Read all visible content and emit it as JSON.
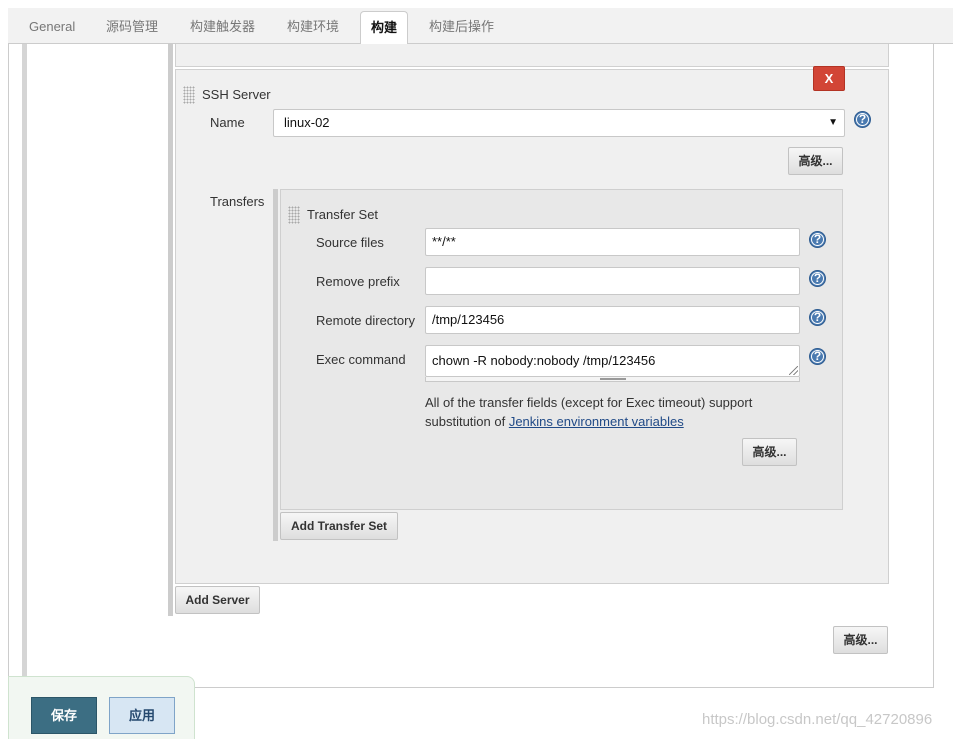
{
  "tabs": [
    {
      "label": "General"
    },
    {
      "label": "源码管理"
    },
    {
      "label": "构建触发器"
    },
    {
      "label": "构建环境"
    },
    {
      "label": "构建",
      "active": true
    },
    {
      "label": "构建后操作"
    }
  ],
  "ssh_server": {
    "section_label": "SSH Server",
    "delete_label": "X",
    "name_label": "Name",
    "name_value": "linux-02",
    "advanced_label": "高级...",
    "transfers_label": "Transfers"
  },
  "transfer_set": {
    "section_label": "Transfer Set",
    "source_files_label": "Source files",
    "source_files_value": "**/**",
    "remove_prefix_label": "Remove prefix",
    "remove_prefix_value": "",
    "remote_directory_label": "Remote directory",
    "remote_directory_value": "/tmp/123456",
    "exec_command_label": "Exec command",
    "exec_command_value": "chown -R nobody:nobody /tmp/123456",
    "note_prefix": "All of the transfer fields (except for Exec timeout) support substitution of ",
    "note_link": "Jenkins environment variables",
    "advanced_label": "高级...",
    "add_transfer_set_label": "Add Transfer Set"
  },
  "add_server_label": "Add Server",
  "build_advanced_label": "高级...",
  "footer": {
    "save_label": "保存",
    "apply_label": "应用"
  },
  "watermark": "https://blog.csdn.net/qq_42720896",
  "icons": {
    "help": "help-icon",
    "drag": "drag-handle-icon"
  },
  "colors": {
    "delete_button": "#d24536",
    "save_button": "#3c6e83",
    "apply_button": "#d7e6f3",
    "help_icon": "#4a7ab0",
    "link": "#204a87"
  }
}
